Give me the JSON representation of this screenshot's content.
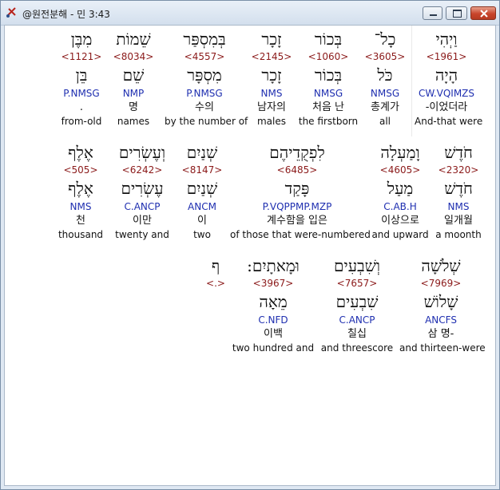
{
  "window": {
    "title": "@원전분해 - 민 3:43"
  },
  "rows": [
    [
      {
        "heb": "וַיְהִי",
        "strong": "<1961>",
        "lex": "הָיָה",
        "parse": "CW.VQIMZS",
        "ko": "-이었더라",
        "en": "And-that were"
      },
      {
        "heb": "כָל־",
        "strong": "<3605>",
        "lex": "כֹּל",
        "parse": "NMSG",
        "ko": "총계가",
        "en": "all"
      },
      {
        "heb": "בְּכוֹר",
        "strong": "<1060>",
        "lex": "בְּכוֹר",
        "parse": "NMSG",
        "ko": "처음 난",
        "en": "the firstborn"
      },
      {
        "heb": "זָכָר",
        "strong": "<2145>",
        "lex": "זָכָר",
        "parse": "NMS",
        "ko": "남자의",
        "en": "males"
      },
      {
        "heb": "בְּמִסְפַּר",
        "strong": "<4557>",
        "lex": "מִסְפָּר",
        "parse": "P.NMSG",
        "ko": "수의",
        "en": "by the number of"
      },
      {
        "heb": "שֵׁמוֹת",
        "strong": "<8034>",
        "lex": "שֵׁם",
        "parse": "NMP",
        "ko": "명",
        "en": "names"
      },
      {
        "heb": "מִבֶּן",
        "strong": "<1121>",
        "lex": "בֵּן",
        "parse": "P.NMSG",
        "ko": ".",
        "en": "from-old"
      }
    ],
    [
      {
        "heb": "חֹדֶשׁ",
        "strong": "<2320>",
        "lex": "חֹדֶשׁ",
        "parse": "NMS",
        "ko": "일개월",
        "en": "a moonth"
      },
      {
        "heb": "וָמַעְלָה",
        "strong": "<4605>",
        "lex": "מַעַל",
        "parse": "C.AB.H",
        "ko": "이상으로",
        "en": "and upward"
      },
      {
        "heb": "לִפְקֻדֵיהֶם",
        "strong": "<6485>",
        "lex": "פָּקַד",
        "parse": "P.VQPPMP.MZP",
        "ko": "계수함을 입은",
        "en": "of those that were-numbered"
      },
      {
        "heb": "שְׁנַיִם",
        "strong": "<8147>",
        "lex": "שְׁנַיִם",
        "parse": "ANCM",
        "ko": "이",
        "en": "two"
      },
      {
        "heb": "וְעֶשְׂרִים",
        "strong": "<6242>",
        "lex": "עֶשְׂרִים",
        "parse": "C.ANCP",
        "ko": "이만",
        "en": "twenty and"
      },
      {
        "heb": "אֶלֶף",
        "strong": "<505>",
        "lex": "אֶלֶף",
        "parse": "NMS",
        "ko": "천",
        "en": "thousand"
      }
    ],
    [
      {
        "heb": "שְׁלֹשָׁה",
        "strong": "<7969>",
        "lex": "שָׁלוֹשׁ",
        "parse": "ANCFS",
        "ko": "삼 명-",
        "en": "and thirteen-were"
      },
      {
        "heb": "וְשִׁבְעִים",
        "strong": "<7657>",
        "lex": "שִׁבְעִים",
        "parse": "C.ANCP",
        "ko": "칠십",
        "en": "and threescore"
      },
      {
        "heb": "וּמָאתָיִם:",
        "strong": "<3967>",
        "lex": "מֵאָה",
        "parse": "C.NFD",
        "ko": "이백",
        "en": "two hundred and"
      },
      {
        "heb": "ף",
        "strong": "<.>",
        "lex": "",
        "parse": "",
        "ko": "",
        "en": ""
      }
    ]
  ]
}
